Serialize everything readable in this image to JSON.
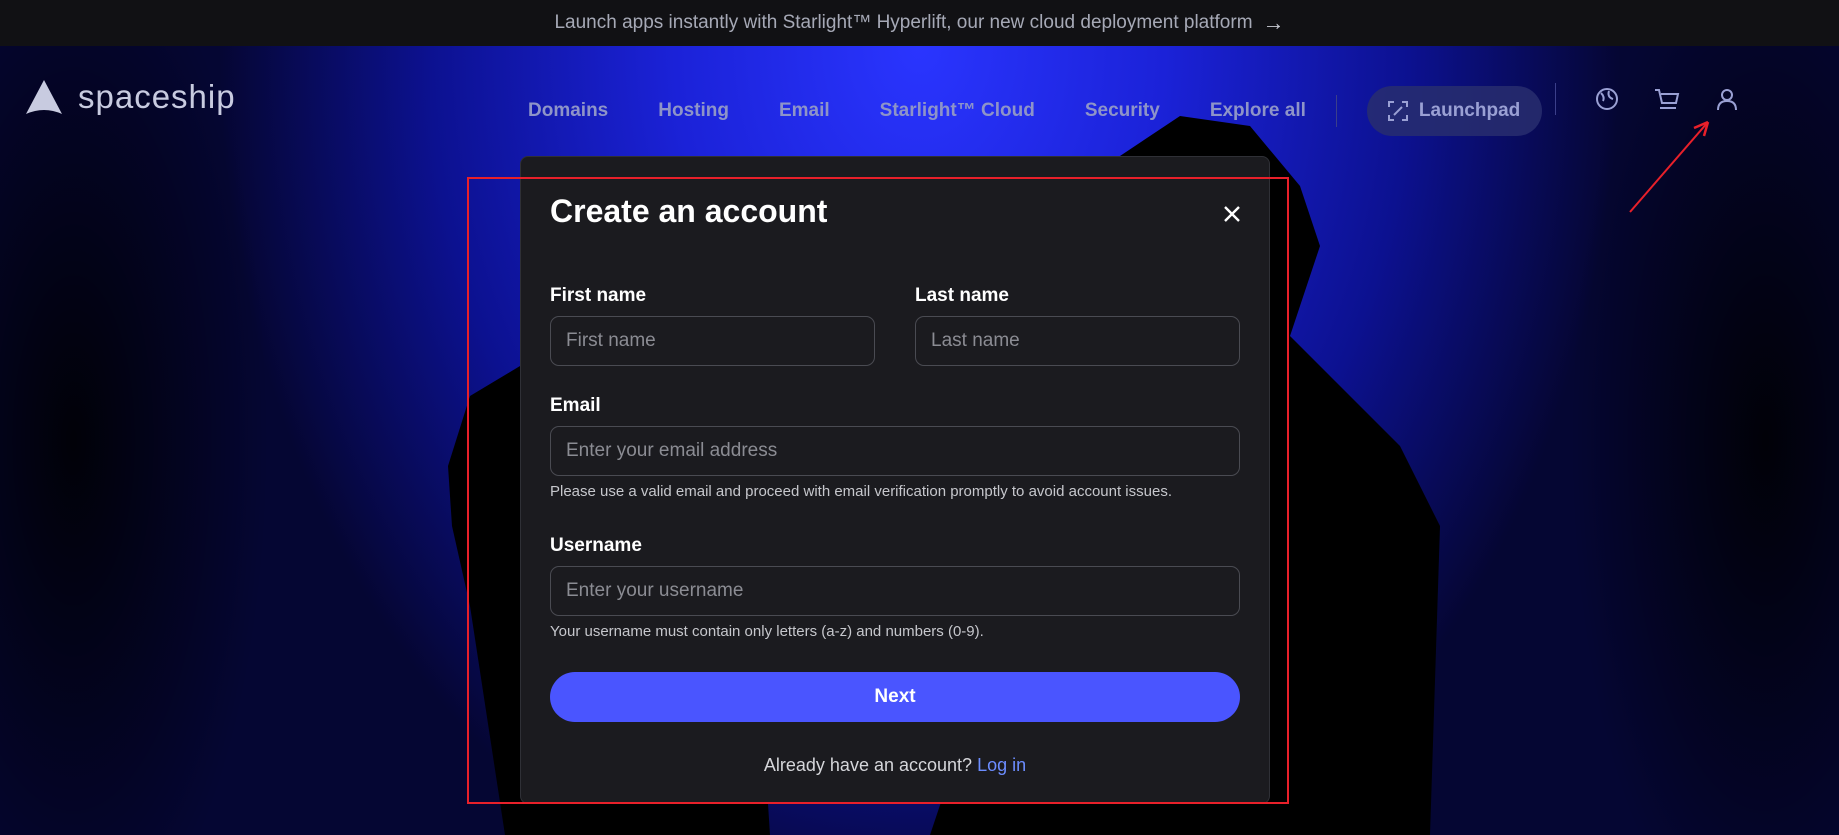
{
  "banner": {
    "text": "Launch apps instantly with Starlight™ Hyperlift, our new cloud deployment platform",
    "arrow_icon": "arrow-right-icon"
  },
  "header": {
    "logo_text": "spaceship",
    "nav": [
      "Domains",
      "Hosting",
      "Email",
      "Starlight™ Cloud",
      "Security",
      "Explore all"
    ],
    "launchpad_label": "Launchpad",
    "icons": [
      "language-icon",
      "cart-icon",
      "user-icon"
    ]
  },
  "modal": {
    "title": "Create an account",
    "first_name": {
      "label": "First name",
      "placeholder": "First name",
      "value": ""
    },
    "last_name": {
      "label": "Last name",
      "placeholder": "Last name",
      "value": ""
    },
    "email": {
      "label": "Email",
      "placeholder": "Enter your email address",
      "value": "",
      "hint": "Please use a valid email and proceed with email verification promptly to avoid account issues."
    },
    "username": {
      "label": "Username",
      "placeholder": "Enter your username",
      "value": "",
      "hint": "Your username must contain only letters (a-z) and numbers (0-9)."
    },
    "next_label": "Next",
    "footer_text": "Already have an account?",
    "login_link": "Log in"
  },
  "colors": {
    "accent": "#4a55ff",
    "link": "#6c8dff",
    "modal_bg": "#1b1b1f",
    "annotation": "#e8202a"
  }
}
